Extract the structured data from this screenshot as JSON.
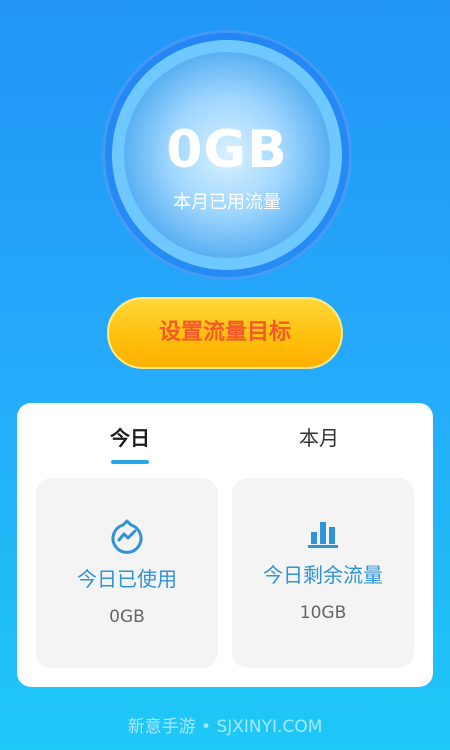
{
  "usage_gauge": {
    "value": "0GB",
    "label": "本月已用流量"
  },
  "target_button": {
    "label": "设置流量目标"
  },
  "tabs": [
    {
      "label": "今日",
      "active": true
    },
    {
      "label": "本月",
      "active": false
    }
  ],
  "stats": {
    "used": {
      "icon": "data-usage-icon",
      "title": "今日已使用",
      "value": "0GB"
    },
    "remaining": {
      "icon": "bar-chart-icon",
      "title": "今日剩余流量",
      "value": "10GB"
    }
  },
  "watermark": "新意手游 • SJXINYI.COM",
  "colors": {
    "background_top": "#2196f7",
    "background_bottom": "#1ec8f7",
    "accent_blue": "#2f93d6",
    "button_yellow": "#ffc00d",
    "button_text": "#f45b2a"
  }
}
